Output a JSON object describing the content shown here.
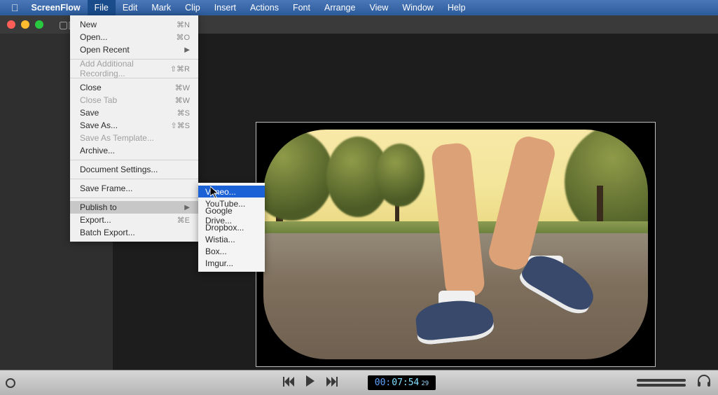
{
  "menubar": {
    "app": "ScreenFlow",
    "items": [
      "File",
      "Edit",
      "Mark",
      "Clip",
      "Insert",
      "Actions",
      "Font",
      "Arrange",
      "View",
      "Window",
      "Help"
    ],
    "open_index": 0
  },
  "file_menu": {
    "new_label": "New",
    "new_sc": "⌘N",
    "open_label": "Open...",
    "open_sc": "⌘O",
    "open_recent_label": "Open Recent",
    "add_rec_label": "Add Additional Recording...",
    "add_rec_sc": "⇧⌘R",
    "close_label": "Close",
    "close_sc": "⌘W",
    "close_tab_label": "Close Tab",
    "close_tab_sc": "⌘W",
    "save_label": "Save",
    "save_sc": "⌘S",
    "saveas_label": "Save As...",
    "saveas_sc": "⇧⌘S",
    "save_tpl_label": "Save As Template...",
    "archive_label": "Archive...",
    "doc_settings_label": "Document Settings...",
    "save_frame_label": "Save Frame...",
    "publish_label": "Publish to",
    "export_label": "Export...",
    "export_sc": "⌘E",
    "batch_label": "Batch Export..."
  },
  "publish_submenu": {
    "vimeo": "Vimeo...",
    "youtube": "YouTube...",
    "gdrive": "Google Drive...",
    "dropbox": "Dropbox...",
    "wistia": "Wistia...",
    "box": "Box...",
    "imgur": "Imgur..."
  },
  "transport": {
    "timecode_prefix": "00:",
    "timecode_main": "07:54",
    "timecode_frames": "29"
  }
}
